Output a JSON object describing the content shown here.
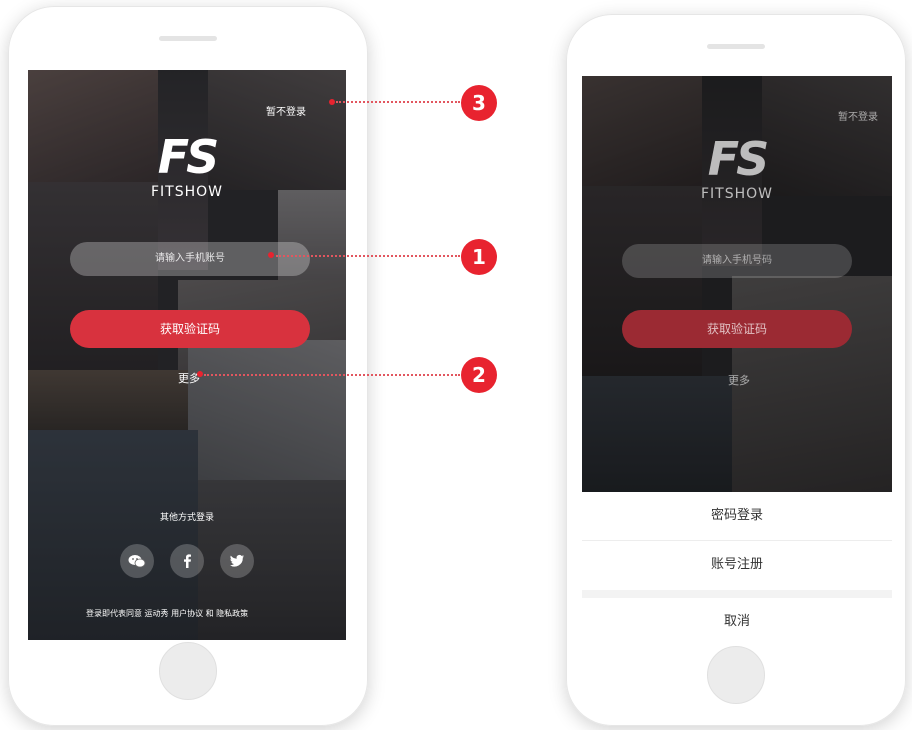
{
  "login_screen": {
    "skip_label": "暂不登录",
    "logo_mark": "FS",
    "brand_name": "FITSHOW",
    "phone_placeholder": "请输入手机账号",
    "primary_button": "获取验证码",
    "more_label": "更多",
    "other_login_label": "其他方式登录",
    "social_icons": [
      "wechat-icon",
      "facebook-icon",
      "twitter-icon"
    ],
    "terms_text": "登录即代表同意 运动秀 用户协议 和 隐私政策"
  },
  "sheet_screen": {
    "skip_label": "暂不登录",
    "logo_mark": "FS",
    "brand_name": "FITSHOW",
    "phone_placeholder": "请输入手机号码",
    "primary_button": "获取验证码",
    "more_label": "更多",
    "sheet_items": [
      "密码登录",
      "账号注册"
    ],
    "cancel_label": "取消"
  },
  "callouts": [
    "3",
    "1",
    "2"
  ],
  "colors": {
    "accent": "#d8323e",
    "badge": "#e8232f"
  }
}
